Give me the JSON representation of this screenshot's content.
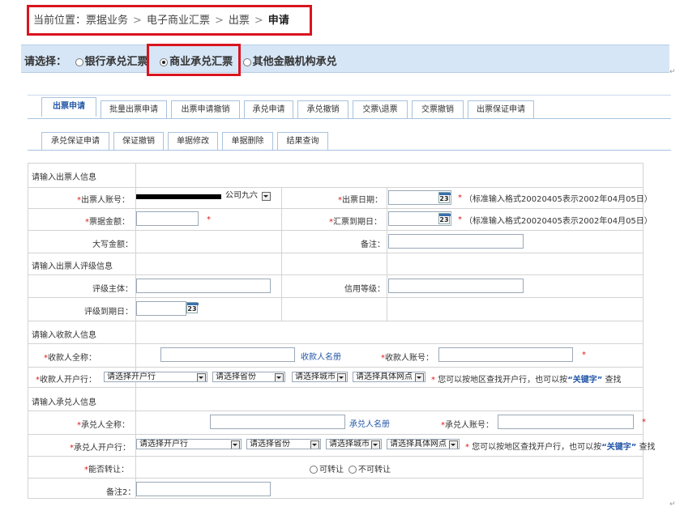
{
  "breadcrumb": {
    "prefix": "当前位置：",
    "items": [
      "票据业务",
      "电子商业汇票",
      "出票"
    ],
    "current": "申请",
    "sep": ">"
  },
  "selector": {
    "label": "请选择：",
    "options": [
      "银行承兑汇票",
      "商业承兑汇票",
      "其他金融机构承兑"
    ],
    "selected": 1
  },
  "tabs_row1": [
    "出票申请",
    "批量出票申请",
    "出票申请撤销",
    "承兑申请",
    "承兑撤销",
    "交票\\退票",
    "交票撤销",
    "出票保证申请"
  ],
  "tabs_row2": [
    "承兑保证申请",
    "保证撤销",
    "单据修改",
    "单据删除",
    "结果查询"
  ],
  "sections": {
    "drawer": "请输入出票人信息",
    "rating": "请输入出票人评级信息",
    "payee": "请输入收款人信息",
    "acceptor": "请输入承兑人信息"
  },
  "form": {
    "drawer_account_label": "出票人账号：",
    "drawer_account_value": "公司九六",
    "issue_date_label": "出票日期：",
    "date_hint": "（标准输入格式20020405表示2002年04月05日）",
    "amount_label": "票据金额：",
    "due_date_label": "汇票到期日：",
    "amount_words_label": "大写金额：",
    "remark_label": "备注：",
    "rating_subject_label": "评级主体：",
    "credit_level_label": "信用等级：",
    "rating_due_label": "评级到期日：",
    "payee_name_label": "收款人全称：",
    "payee_lookup": "收款人名册",
    "payee_account_label": "收款人账号：",
    "payee_bank_label": "收款人开户行：",
    "acceptor_name_label": "承兑人全称：",
    "acceptor_lookup": "承兑人名册",
    "acceptor_account_label": "承兑人账号：",
    "acceptor_bank_label": "承兑人开户行：",
    "transferable_label": "能否转让：",
    "transfer_yes": "可转让",
    "transfer_no": "不可转让",
    "remark2_label": "备注2：",
    "select_bank": "请选择开户行",
    "select_province": "请选择省份",
    "select_city": "请选择城市",
    "select_branch": "请选择具体网点",
    "hint_prefix": "您可以按地区查找开户行，也可以按",
    "hint_keyword": "“关键字”",
    "hint_suffix": "查找",
    "cal_day": "23",
    "required": "*"
  }
}
